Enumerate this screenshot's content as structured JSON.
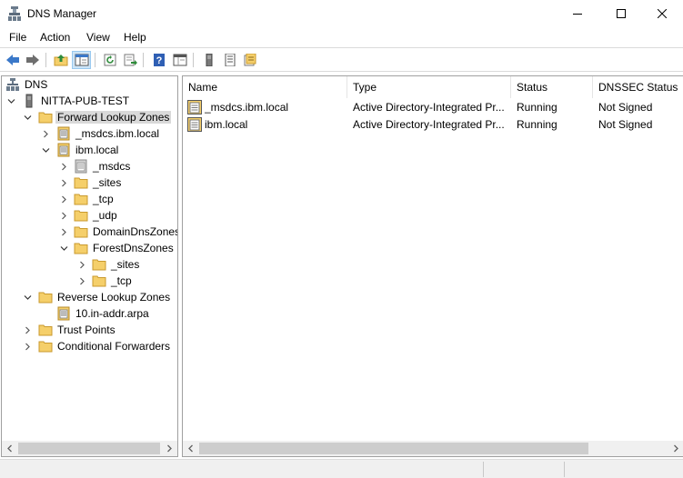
{
  "window": {
    "title": "DNS Manager",
    "icon": "dns-manager-icon"
  },
  "menu": {
    "items": [
      "File",
      "Action",
      "View",
      "Help"
    ]
  },
  "toolbar": {
    "buttons": [
      "back-icon",
      "forward-icon",
      "up-folder-icon",
      "show-hide-tree-icon",
      "refresh-icon",
      "export-list-icon",
      "help-icon",
      "properties-icon",
      "server-icon",
      "zone-list-icon",
      "new-zone-icon"
    ]
  },
  "tree": {
    "root": "DNS",
    "server": "NITTA-PUB-TEST",
    "forward_lookup_zones": "Forward Lookup Zones",
    "msdcs_ibm_local": "_msdcs.ibm.local",
    "ibm_local": "ibm.local",
    "msdcs": "_msdcs",
    "sites": "_sites",
    "tcp": "_tcp",
    "udp": "_udp",
    "domain_dns_zones": "DomainDnsZones",
    "forest_dns_zones": "ForestDnsZones",
    "forest_sites": "_sites",
    "forest_tcp": "_tcp",
    "reverse_lookup_zones": "Reverse Lookup Zones",
    "reverse_zone": "10.in-addr.arpa",
    "trust_points": "Trust Points",
    "conditional_forwarders": "Conditional Forwarders",
    "selected": "Forward Lookup Zones"
  },
  "list": {
    "columns": [
      "Name",
      "Type",
      "Status",
      "DNSSEC Status"
    ],
    "rows": [
      {
        "name": "_msdcs.ibm.local",
        "type": "Active Directory-Integrated Pr...",
        "status": "Running",
        "dnssec": "Not Signed"
      },
      {
        "name": "ibm.local",
        "type": "Active Directory-Integrated Pr...",
        "status": "Running",
        "dnssec": "Not Signed"
      }
    ]
  },
  "colors": {
    "selection": "#d9d9d9",
    "folder": "#f5cf6a",
    "toolbar_active": "#cce4f7",
    "scrollbar_track": "#f0f0f0",
    "scrollbar_thumb": "#cdcdcd"
  }
}
